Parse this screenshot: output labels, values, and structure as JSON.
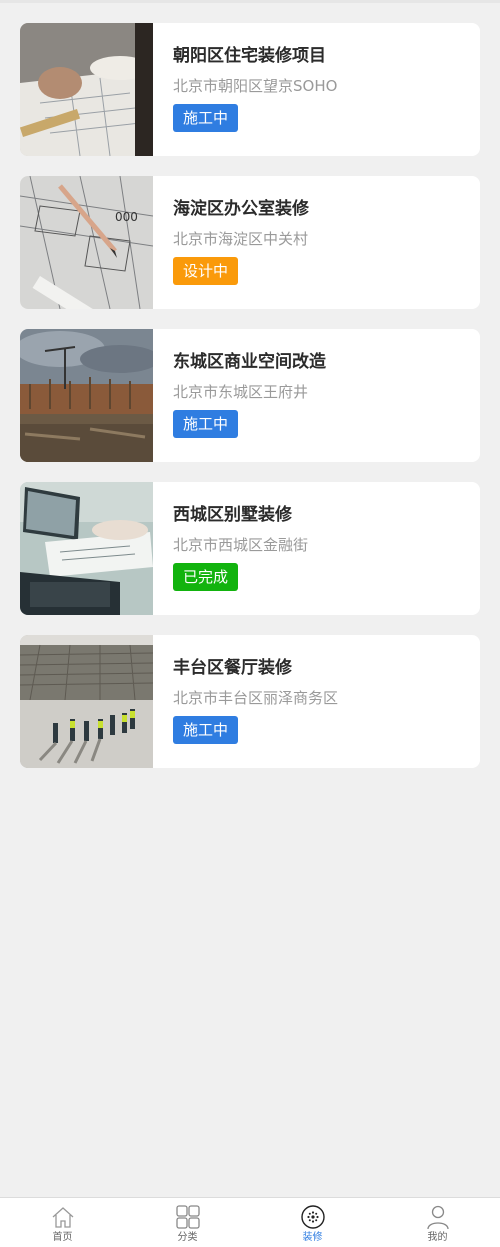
{
  "projects": [
    {
      "title": "朝阳区住宅装修项目",
      "address": "北京市朝阳区望京SOHO",
      "status": "施工中",
      "status_color": "#2f7de1",
      "image": "drafting-blueprint-photo"
    },
    {
      "title": "海淀区办公室装修",
      "address": "北京市海淀区中关村",
      "status": "设计中",
      "status_color": "#fa9a0a",
      "image": "pencil-blueprint-photo"
    },
    {
      "title": "东城区商业空间改造",
      "address": "北京市东城区王府井",
      "status": "施工中",
      "status_color": "#2f7de1",
      "image": "construction-site-photo"
    },
    {
      "title": "西城区别墅装修",
      "address": "北京市西城区金融街",
      "status": "已完成",
      "status_color": "#12b30e",
      "image": "laptop-plans-photo"
    },
    {
      "title": "丰台区餐厅装修",
      "address": "北京市丰台区丽泽商务区",
      "status": "施工中",
      "status_color": "#2f7de1",
      "image": "workers-site-aerial-photo"
    }
  ],
  "tabbar": {
    "items": [
      {
        "label": "首页",
        "icon": "home-icon",
        "active": false
      },
      {
        "label": "分类",
        "icon": "grid-icon",
        "active": false
      },
      {
        "label": "装修",
        "icon": "renovation-icon",
        "active": true
      },
      {
        "label": "我的",
        "icon": "user-icon",
        "active": false
      }
    ],
    "active_color": "#2f7de1"
  }
}
